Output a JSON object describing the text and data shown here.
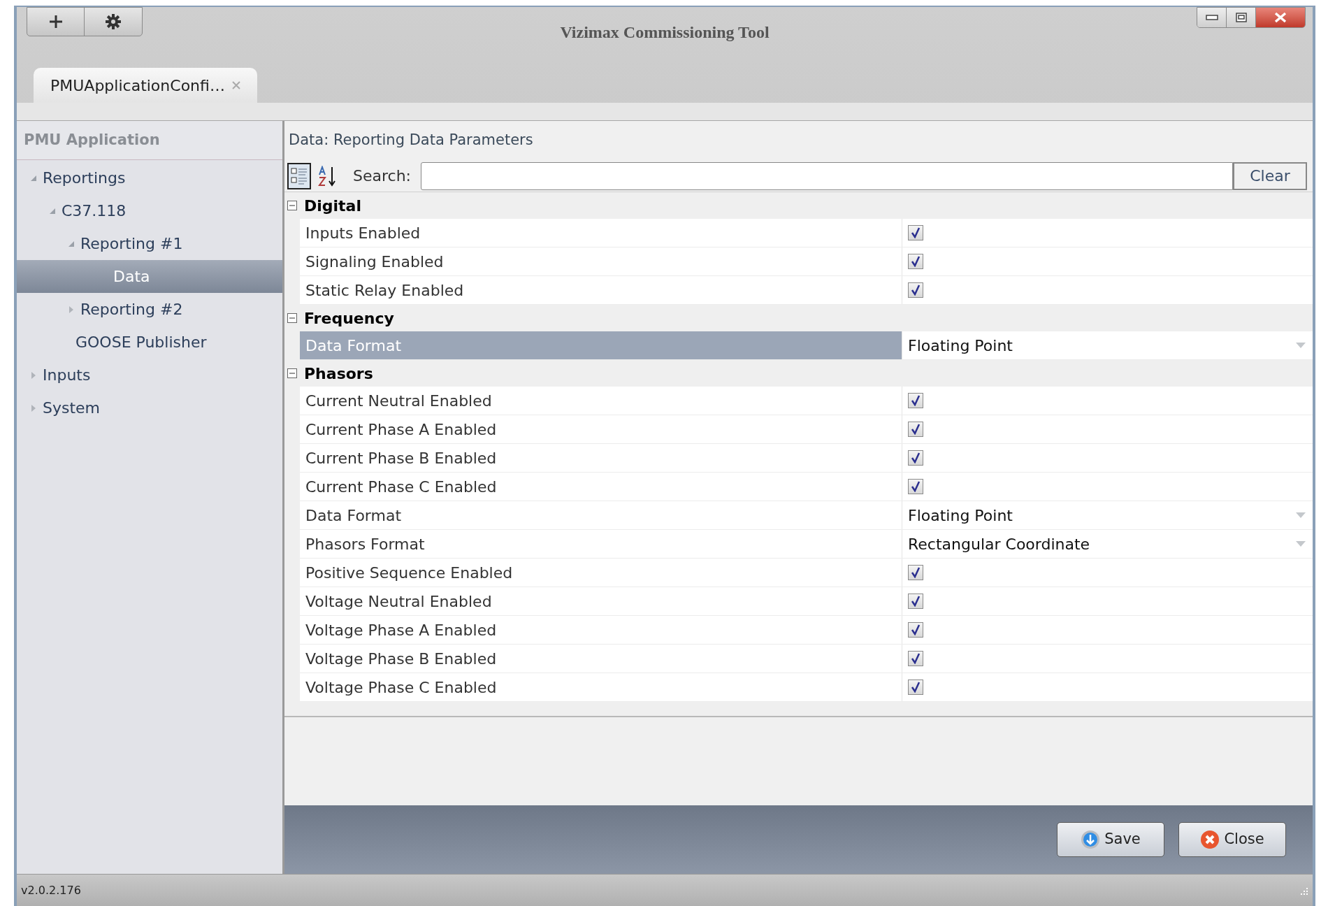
{
  "window": {
    "title": "Vizimax Commissioning Tool"
  },
  "tabs": [
    {
      "label": "PMUApplicationConfi…",
      "selected": true
    }
  ],
  "sidebar": {
    "title": "PMU Application",
    "tree": [
      {
        "label": "Reportings",
        "expanded": true,
        "selected": false,
        "children": [
          {
            "label": "C37.118",
            "expanded": true,
            "selected": false,
            "children": [
              {
                "label": "Reporting #1",
                "expanded": true,
                "selected": false,
                "children": [
                  {
                    "label": "Data",
                    "selected": true
                  }
                ]
              },
              {
                "label": "Reporting #2",
                "expanded": false,
                "selected": false
              }
            ]
          },
          {
            "label": "GOOSE Publisher",
            "selected": false
          }
        ]
      },
      {
        "label": "Inputs",
        "expanded": false,
        "selected": false
      },
      {
        "label": "System",
        "expanded": false,
        "selected": false
      }
    ]
  },
  "panel": {
    "title": "Data: Reporting Data Parameters",
    "toolbar": [
      {
        "kind": "categorized",
        "selected": true
      },
      {
        "kind": "alphabetical",
        "selected": false
      }
    ],
    "search": {
      "label": "Search:"
    },
    "clear_button": "Clear",
    "categories": [
      {
        "name": "Digital",
        "expanded": true,
        "rows": [
          {
            "label": "Inputs Enabled",
            "kind": "checkbox",
            "checked": true,
            "selected": false
          },
          {
            "label": "Signaling Enabled",
            "kind": "checkbox",
            "checked": true,
            "selected": false
          },
          {
            "label": "Static Relay Enabled",
            "kind": "checkbox",
            "checked": true,
            "selected": false
          }
        ]
      },
      {
        "name": "Frequency",
        "expanded": true,
        "rows": [
          {
            "label": "Data Format",
            "kind": "dropdown",
            "value": "Floating Point",
            "selected": true
          }
        ]
      },
      {
        "name": "Phasors",
        "expanded": true,
        "rows": [
          {
            "label": "Current Neutral Enabled",
            "kind": "checkbox",
            "checked": true,
            "selected": false
          },
          {
            "label": "Current Phase A Enabled",
            "kind": "checkbox",
            "checked": true,
            "selected": false
          },
          {
            "label": "Current Phase B Enabled",
            "kind": "checkbox",
            "checked": true,
            "selected": false
          },
          {
            "label": "Current Phase C Enabled",
            "kind": "checkbox",
            "checked": true,
            "selected": false
          },
          {
            "label": "Data Format",
            "kind": "dropdown",
            "value": "Floating Point",
            "selected": false
          },
          {
            "label": "Phasors Format",
            "kind": "dropdown",
            "value": "Rectangular Coordinate",
            "selected": false
          },
          {
            "label": "Positive Sequence Enabled",
            "kind": "checkbox",
            "checked": true,
            "selected": false
          },
          {
            "label": "Voltage Neutral Enabled",
            "kind": "checkbox",
            "checked": true,
            "selected": false
          },
          {
            "label": "Voltage Phase A Enabled",
            "kind": "checkbox",
            "checked": true,
            "selected": false
          },
          {
            "label": "Voltage Phase B Enabled",
            "kind": "checkbox",
            "checked": true,
            "selected": false
          },
          {
            "label": "Voltage Phase C Enabled",
            "kind": "checkbox",
            "checked": true,
            "selected": false
          }
        ]
      }
    ]
  },
  "buttons": [
    {
      "kind": "save",
      "label": "Save"
    },
    {
      "kind": "close",
      "label": "Close"
    }
  ],
  "status_bar": {
    "version": "v2.0.2.176"
  }
}
